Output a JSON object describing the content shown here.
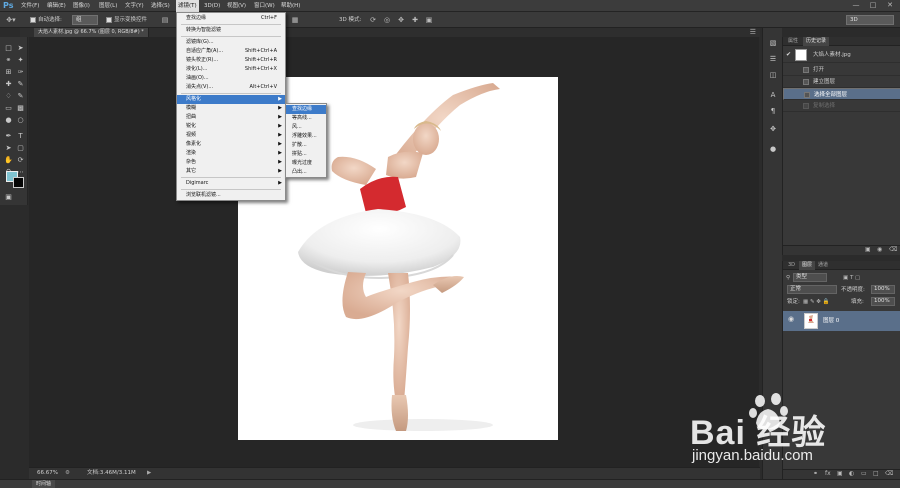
{
  "app": {
    "logo": "Ps",
    "menus": [
      "文件(F)",
      "编辑(E)",
      "图像(I)",
      "图层(L)",
      "文字(Y)",
      "选择(S)",
      "滤镜(T)",
      "3D(D)",
      "视图(V)",
      "窗口(W)",
      "帮助(H)"
    ],
    "active_menu": "滤镜(T)"
  },
  "options_bar": {
    "auto_select_label": "自动选择:",
    "auto_select_value": "组",
    "show_transform_label": "显示变换控件",
    "mode_3d_label": "3D 模式:",
    "workspace_value": "3D"
  },
  "document": {
    "tab_label": "大焰人素材.jpg @ 66.7% (图层 0, RGB/8#) *",
    "zoom": "66.67%",
    "doc_size": "文档:3.46M/3.11M"
  },
  "timeline_tab": "时间轴",
  "history_panel": {
    "tabs": [
      "属性",
      "历史记录"
    ],
    "snapshot_name": "大焰人素材.jpg",
    "steps": [
      "打开",
      "建立图层",
      "选择全部图层",
      "复制选择"
    ],
    "selected_index": 2
  },
  "layers_panel": {
    "tabs": [
      "3D",
      "图层",
      "通道"
    ],
    "filter_kind": "类型",
    "blend_mode": "正常",
    "opacity_label": "不透明度:",
    "opacity_value": "100%",
    "lock_label": "锁定:",
    "fill_label": "填充:",
    "fill_value": "100%",
    "layer_name": "图层 0"
  },
  "filter_menu": {
    "items": [
      {
        "label": "查找边缘",
        "shortcut": "Ctrl+F"
      },
      {
        "sep": true
      },
      {
        "label": "转换为智能滤镜"
      },
      {
        "sep": true
      },
      {
        "label": "滤镜库(G)..."
      },
      {
        "label": "自适应广角(A)...",
        "shortcut": "Shift+Ctrl+A"
      },
      {
        "label": "镜头校正(R)...",
        "shortcut": "Shift+Ctrl+R"
      },
      {
        "label": "液化(L)...",
        "shortcut": "Shift+Ctrl+X"
      },
      {
        "label": "油画(O)..."
      },
      {
        "label": "消失点(V)...",
        "shortcut": "Alt+Ctrl+V"
      },
      {
        "sep": true
      },
      {
        "label": "风格化",
        "submenu": true,
        "highlight": true
      },
      {
        "label": "模糊",
        "submenu": true
      },
      {
        "label": "扭曲",
        "submenu": true
      },
      {
        "label": "锐化",
        "submenu": true
      },
      {
        "label": "视频",
        "submenu": true
      },
      {
        "label": "像素化",
        "submenu": true
      },
      {
        "label": "渲染",
        "submenu": true
      },
      {
        "label": "杂色",
        "submenu": true
      },
      {
        "label": "其它",
        "submenu": true
      },
      {
        "sep": true
      },
      {
        "label": "Digimarc",
        "submenu": true
      },
      {
        "sep": true
      },
      {
        "label": "浏览联机滤镜..."
      }
    ]
  },
  "stylize_submenu": {
    "items": [
      "查找边缘",
      "等高线...",
      "风...",
      "浮雕效果...",
      "扩散...",
      "拼贴...",
      "曝光过度",
      "凸出..."
    ],
    "highlight_index": 0
  },
  "watermark": {
    "text": "Bai 经验",
    "url": "jingyan.baidu.com"
  }
}
